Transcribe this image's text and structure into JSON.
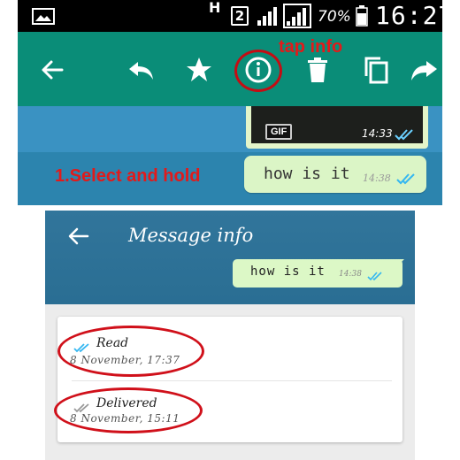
{
  "status_bar": {
    "network": "H",
    "sim": "2",
    "battery": "70%",
    "time": "16:27"
  },
  "action_bar": {
    "icons": [
      "back-arrow-icon",
      "reply-icon",
      "star-icon",
      "info-icon",
      "delete-icon",
      "copy-icon",
      "forward-icon"
    ]
  },
  "chat": {
    "gif_message": {
      "badge": "GIF",
      "time": "14:33"
    },
    "text_message": {
      "text": "how is it",
      "time": "14:38"
    }
  },
  "annotations": {
    "tap_info": "tap info",
    "select_hold": "1.Select and hold"
  },
  "message_info": {
    "title": "Message info",
    "bubble_text": "how is it",
    "bubble_time": "14:38",
    "read_label": "Read",
    "read_date": "8 November, 17:37",
    "delivered_label": "Delivered",
    "delivered_date": "8 November, 15:11"
  },
  "colors": {
    "action_bar": "#0a8d78",
    "chat_background": "#3a92c2",
    "header_blue": "#2a6e93",
    "annotation_red": "#e21a1a",
    "bubble_green": "#dcf8c6",
    "read_tick": "#34b7f1"
  }
}
